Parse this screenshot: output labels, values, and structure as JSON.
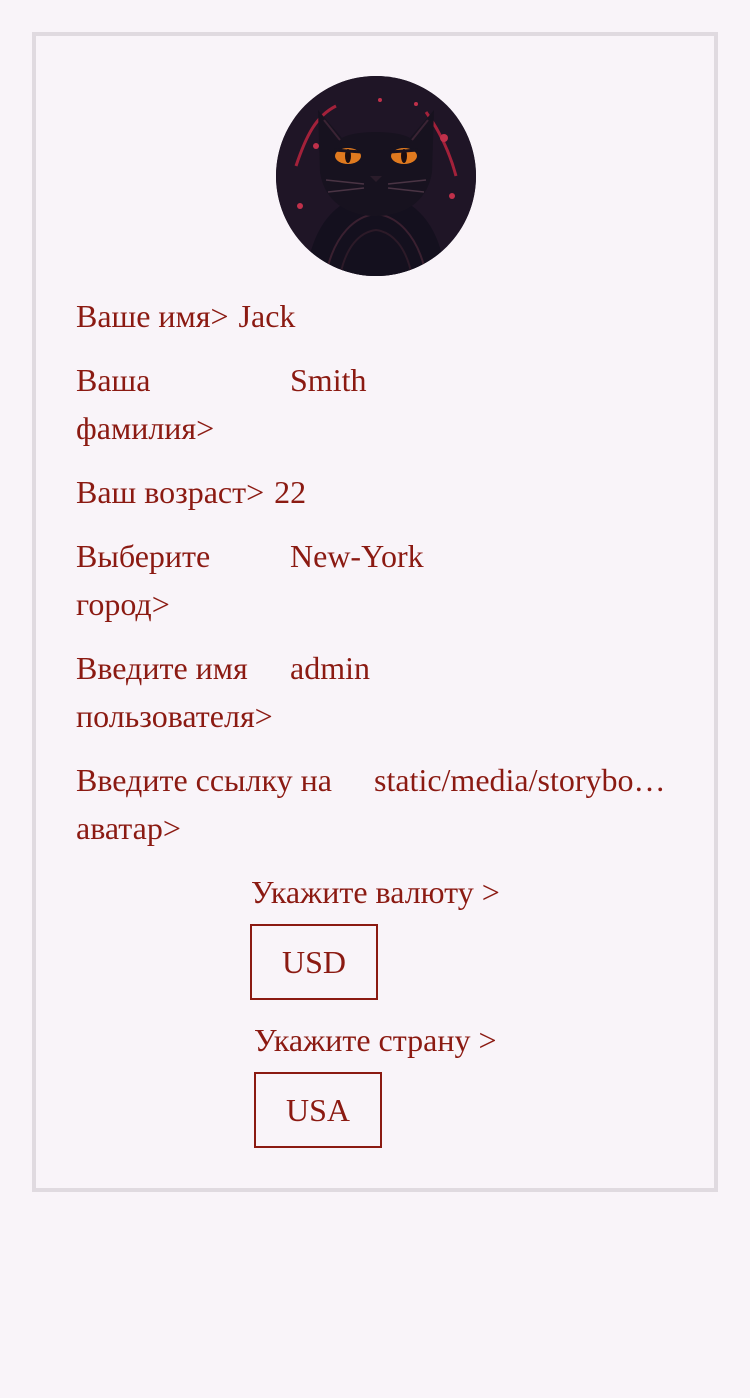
{
  "profile": {
    "avatar_icon": "black-cat-avatar",
    "fields": {
      "first_name": {
        "label": "Ваше имя>",
        "value": "Jack"
      },
      "last_name": {
        "label": "Ваша фамилия>",
        "value": "Smith"
      },
      "age": {
        "label": "Ваш возраст>",
        "value": "22"
      },
      "city": {
        "label": "Выберите город>",
        "value": "New-York"
      },
      "username": {
        "label": "Введите имя пользователя>",
        "value": "admin"
      },
      "avatar_link": {
        "label": "Введите ссылку на аватар>",
        "value": "static/media/storybo…"
      }
    },
    "currency": {
      "label": "Укажите валюту >",
      "value": "USD"
    },
    "country": {
      "label": "Укажите страну >",
      "value": "USA"
    }
  },
  "colors": {
    "text": "#8b1a12",
    "background": "#f9f4f9",
    "card_border": "#e0dae0"
  }
}
